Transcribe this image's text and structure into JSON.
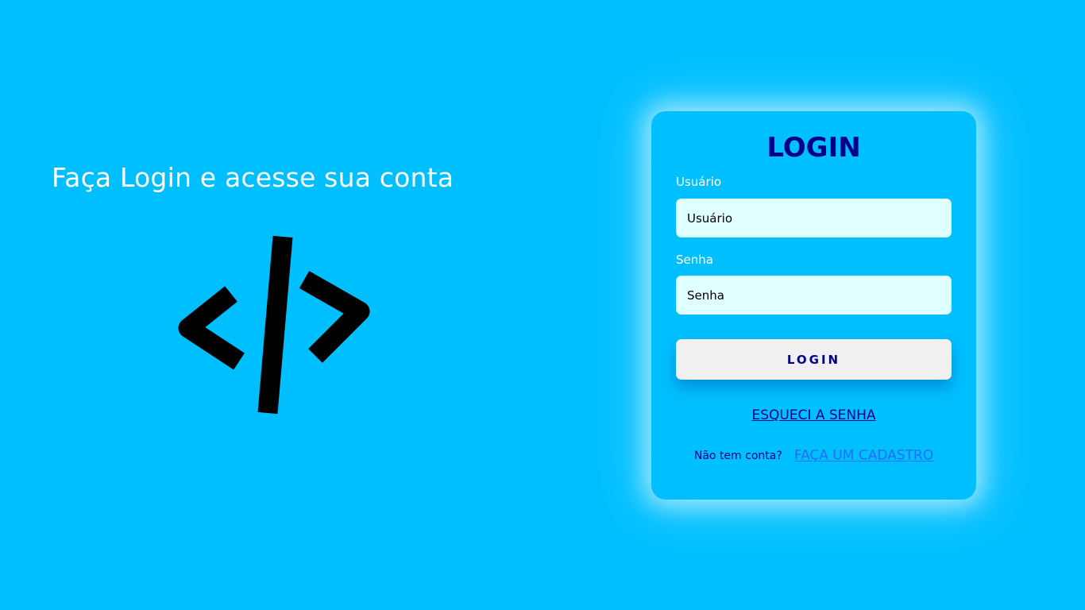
{
  "left_panel": {
    "heading": "Faça Login e acesse sua conta",
    "illustration_icon": "code-brackets-icon"
  },
  "login_card": {
    "title": "LOGIN",
    "username": {
      "label": "Usuário",
      "placeholder": "Usuário",
      "value": ""
    },
    "password": {
      "label": "Senha",
      "placeholder": "Senha",
      "value": ""
    },
    "submit_label": "LOGIN",
    "forgot_password_link": "ESQUECI A SENHA",
    "no_account_text": "Não tem conta?",
    "signup_link": "FAÇA UM CADASTRO"
  },
  "colors": {
    "background": "#00bfff",
    "title": "#00008b",
    "input_background": "#e0ffff",
    "button_background": "#f0f0f0",
    "signup_link": "#1e6fff"
  }
}
